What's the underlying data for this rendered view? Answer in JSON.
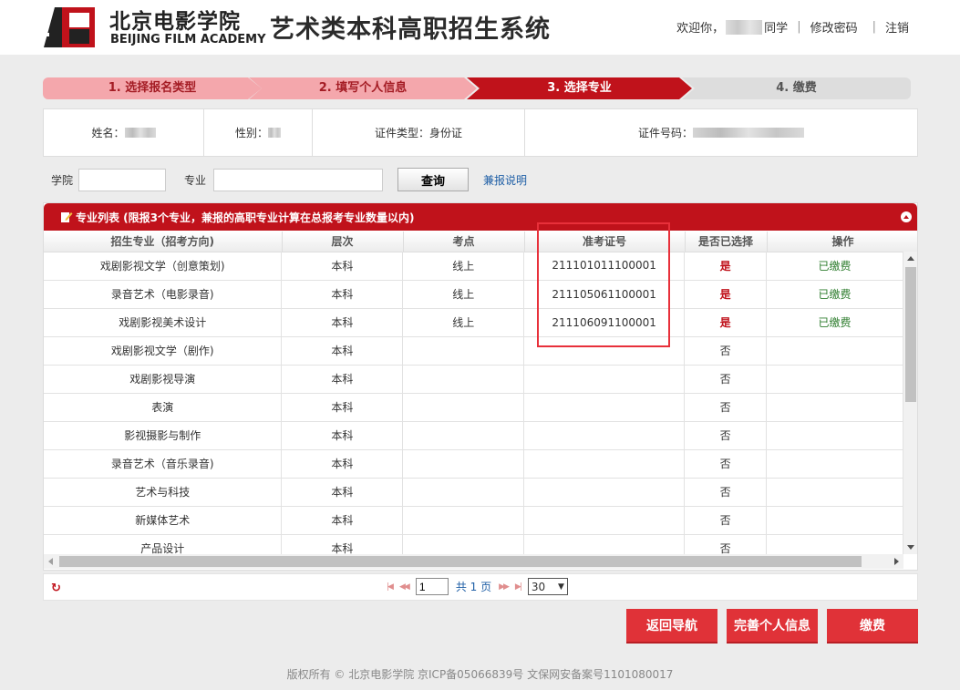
{
  "header": {
    "logo_cn": "北京电影学院",
    "logo_en": "BEIJING FILM ACADEMY",
    "system_title": "艺术类本科高职招生系统",
    "welcome_prefix": "欢迎你，",
    "welcome_suffix": "同学",
    "change_password": "修改密码",
    "logout": "注销"
  },
  "steps": [
    {
      "label": "1. 选择报名类型"
    },
    {
      "label": "2. 填写个人信息"
    },
    {
      "label": "3. 选择专业"
    },
    {
      "label": "4. 缴费"
    }
  ],
  "info": {
    "name_label": "姓名：",
    "gender_label": "性别：",
    "id_type_label": "证件类型：",
    "id_type_value": "身份证",
    "id_number_label": "证件号码："
  },
  "search": {
    "college_label": "学院",
    "major_label": "专业",
    "query_button": "查询",
    "help_link": "兼报说明"
  },
  "panel": {
    "title": "专业列表 (限报3个专业，兼报的高职专业计算在总报考专业数量以内)",
    "columns": [
      "招生专业（招考方向)",
      "层次",
      "考点",
      "准考证号",
      "是否已选择",
      "操作"
    ],
    "rows": [
      [
        "戏剧影视文学（创意策划)",
        "本科",
        "线上",
        "211101011100001",
        "是",
        "已缴费"
      ],
      [
        "录音艺术（电影录音)",
        "本科",
        "线上",
        "211105061100001",
        "是",
        "已缴费"
      ],
      [
        "戏剧影视美术设计",
        "本科",
        "线上",
        "211106091100001",
        "是",
        "已缴费"
      ],
      [
        "戏剧影视文学（剧作)",
        "本科",
        "",
        "",
        "否",
        ""
      ],
      [
        "戏剧影视导演",
        "本科",
        "",
        "",
        "否",
        ""
      ],
      [
        "表演",
        "本科",
        "",
        "",
        "否",
        ""
      ],
      [
        "影视摄影与制作",
        "本科",
        "",
        "",
        "否",
        ""
      ],
      [
        "录音艺术（音乐录音)",
        "本科",
        "",
        "",
        "否",
        ""
      ],
      [
        "艺术与科技",
        "本科",
        "",
        "",
        "否",
        ""
      ],
      [
        "新媒体艺术",
        "本科",
        "",
        "",
        "否",
        ""
      ],
      [
        "产品设计",
        "本科",
        "",
        "",
        "否",
        ""
      ]
    ]
  },
  "pager": {
    "current_page": "1",
    "total_text": "共 1 页",
    "page_size": "30"
  },
  "buttons": {
    "back": "返回导航",
    "complete_info": "完善个人信息",
    "pay": "缴费"
  },
  "footer": {
    "text": "版权所有 © 北京电影学院    京ICP备05066839号    文保网安备案号1101080017"
  },
  "colors": {
    "primary_red": "#c0121b",
    "step_pink": "#f4a7ac",
    "button_red": "#e03238",
    "link_blue": "#1f5fa6",
    "paid_green": "#2e7d2e"
  }
}
